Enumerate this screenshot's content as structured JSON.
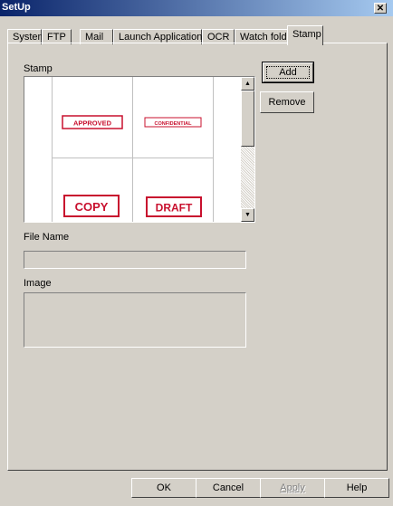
{
  "window": {
    "title": "SetUp",
    "close_glyph": "✕"
  },
  "tabs": [
    {
      "label": "System"
    },
    {
      "label": "FTP"
    },
    {
      "label": "Mail"
    },
    {
      "label": "Launch Application"
    },
    {
      "label": "OCR"
    },
    {
      "label": "Watch folder"
    },
    {
      "label": "Stamp"
    }
  ],
  "active_tab": "Stamp",
  "stamp": {
    "section_label": "Stamp",
    "items": [
      {
        "text": "APPROVED"
      },
      {
        "text": "CONFIDENTIAL"
      },
      {
        "text": "COPY"
      },
      {
        "text": "DRAFT"
      }
    ],
    "stamp_color": "#c8102e",
    "add_label": "Add",
    "remove_label": "Remove"
  },
  "file_name": {
    "label": "File Name",
    "value": ""
  },
  "image": {
    "label": "Image"
  },
  "footer": {
    "ok_label": "OK",
    "cancel_label": "Cancel",
    "apply_label": "Apply",
    "help_label": "Help"
  }
}
